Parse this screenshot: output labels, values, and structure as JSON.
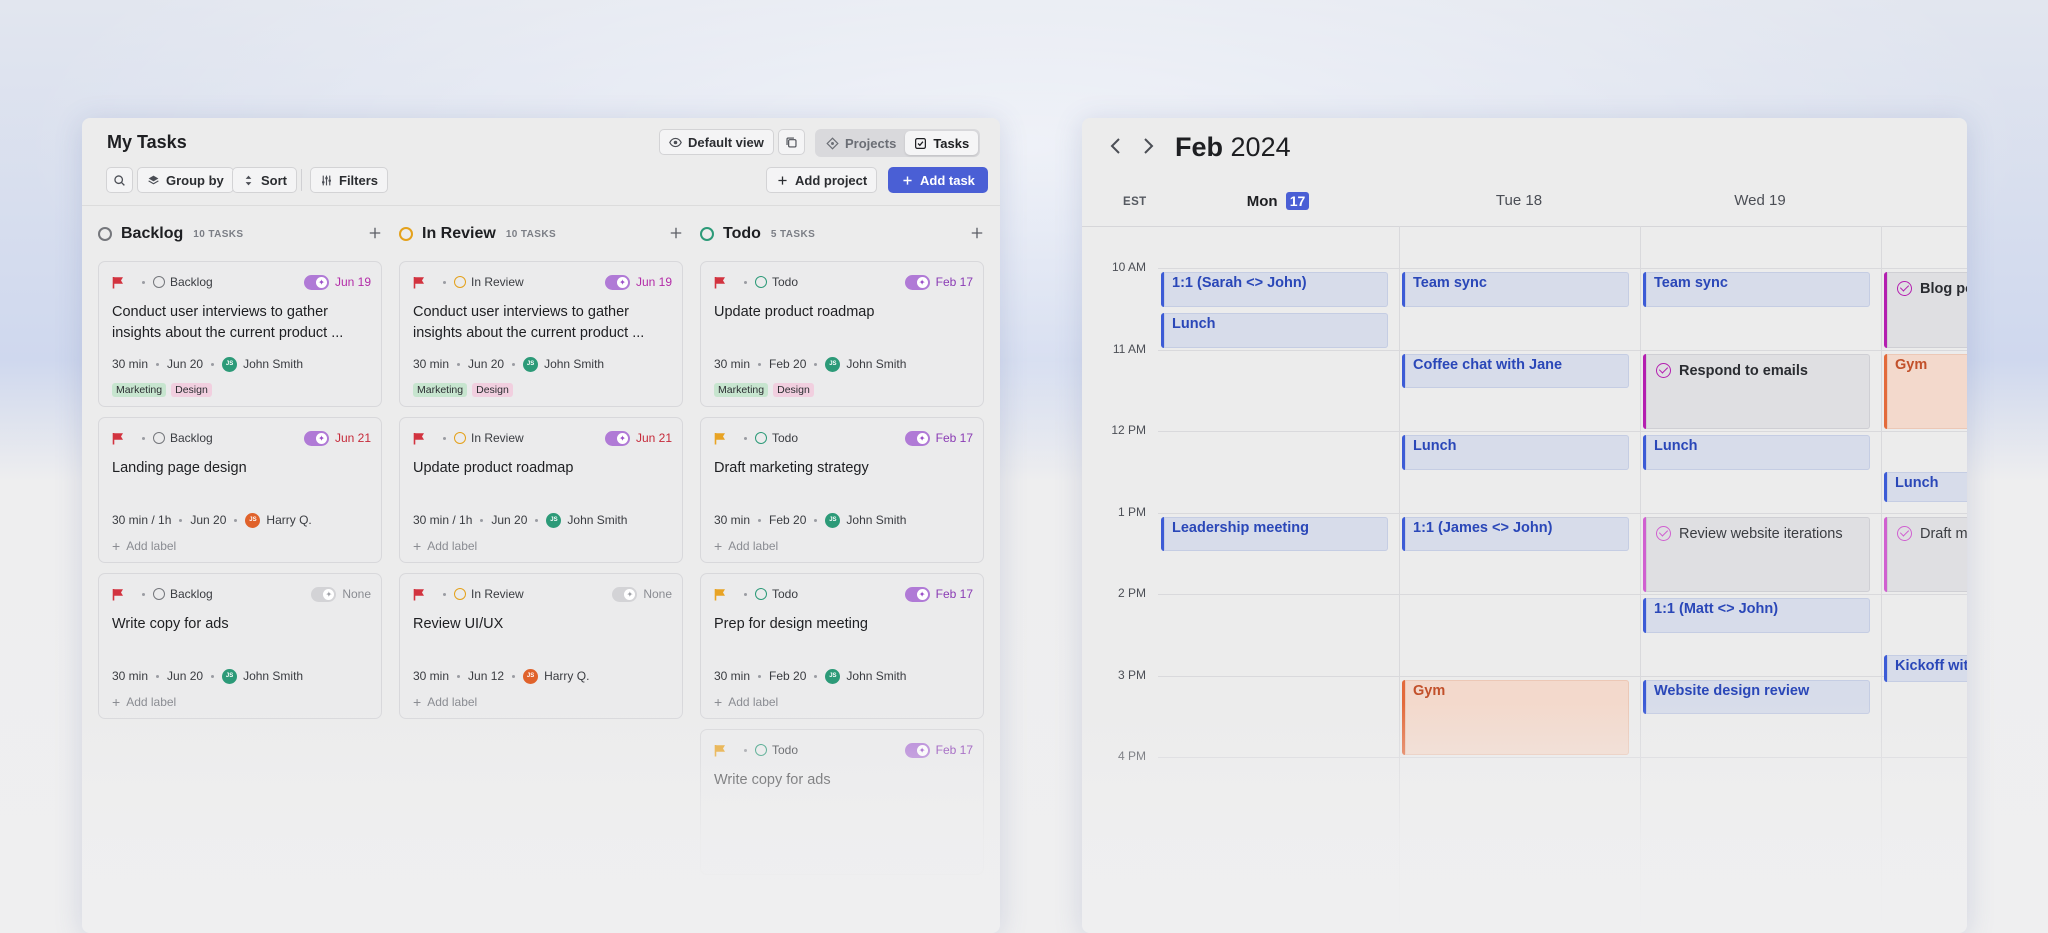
{
  "tasks": {
    "title": "My Tasks",
    "default_view_label": "Default view",
    "segments": [
      {
        "label": "Projects",
        "active": false
      },
      {
        "label": "Tasks",
        "active": true
      }
    ],
    "toolbar": {
      "group_by_label": "Group by",
      "sort_label": "Sort",
      "filters_label": "Filters",
      "add_project_label": "Add project",
      "add_task_label": "Add task"
    },
    "columns": [
      {
        "name": "Backlog",
        "count": "10 TASKS",
        "color": "#75777c",
        "cards": [
          {
            "status": "Backlog",
            "flag_color": "#d2333f",
            "auto": true,
            "due": "Jun 19",
            "due_color": "#b32ca8",
            "title": "Conduct user interviews to gather insights about the current product ...",
            "duration": "30 min",
            "date": "Jun 20",
            "assignee": "John Smith",
            "initials": "JS",
            "avatar_color": "#2c9a78",
            "tags": [
              "Marketing",
              "Design"
            ],
            "add_label": ""
          },
          {
            "status": "Backlog",
            "flag_color": "#d2333f",
            "auto": true,
            "due": "Jun 21",
            "due_color": "#c62a3a",
            "title": "Landing page design",
            "duration": "30 min / 1h",
            "date": "Jun 20",
            "assignee": "Harry Q.",
            "initials": "JS",
            "avatar_color": "#e0622b",
            "tags": [],
            "add_label": "Add label"
          },
          {
            "status": "Backlog",
            "flag_color": "#d2333f",
            "auto": false,
            "due": "None",
            "due_color": "#8a8c92",
            "title": "Write copy for ads",
            "duration": "30 min",
            "date": "Jun 20",
            "assignee": "John Smith",
            "initials": "JS",
            "avatar_color": "#2c9a78",
            "tags": [],
            "add_label": "Add label"
          }
        ]
      },
      {
        "name": "In Review",
        "count": "10 TASKS",
        "color": "#e4a11b",
        "cards": [
          {
            "status": "In Review",
            "flag_color": "#d2333f",
            "auto": true,
            "due": "Jun 19",
            "due_color": "#b32ca8",
            "title": "Conduct user interviews to gather insights about the current product ...",
            "duration": "30 min",
            "date": "Jun 20",
            "assignee": "John Smith",
            "initials": "JS",
            "avatar_color": "#2c9a78",
            "tags": [
              "Marketing",
              "Design"
            ],
            "add_label": ""
          },
          {
            "status": "In Review",
            "flag_color": "#d2333f",
            "auto": true,
            "due": "Jun 21",
            "due_color": "#c62a3a",
            "title": "Update product roadmap",
            "duration": "30 min / 1h",
            "date": "Jun 20",
            "assignee": "John Smith",
            "initials": "JS",
            "avatar_color": "#2c9a78",
            "tags": [],
            "add_label": "Add label"
          },
          {
            "status": "In Review",
            "flag_color": "#d2333f",
            "auto": false,
            "due": "None",
            "due_color": "#8a8c92",
            "title": "Review UI/UX",
            "duration": "30 min",
            "date": "Jun 12",
            "assignee": "Harry Q.",
            "initials": "JS",
            "avatar_color": "#e0622b",
            "tags": [],
            "add_label": "Add label"
          }
        ]
      },
      {
        "name": "Todo",
        "count": "5 TASKS",
        "color": "#2c9a78",
        "cards": [
          {
            "status": "Todo",
            "flag_color": "#d2333f",
            "auto": true,
            "due": "Feb 17",
            "due_color": "#8a3bb4",
            "title": "Update product roadmap",
            "duration": "30 min",
            "date": "Feb 20",
            "assignee": "John Smith",
            "initials": "JS",
            "avatar_color": "#2c9a78",
            "tags": [
              "Marketing",
              "Design"
            ],
            "add_label": ""
          },
          {
            "status": "Todo",
            "flag_color": "#e8a324",
            "auto": true,
            "due": "Feb 17",
            "due_color": "#8a3bb4",
            "title": "Draft marketing strategy",
            "duration": "30 min",
            "date": "Feb 20",
            "assignee": "John Smith",
            "initials": "JS",
            "avatar_color": "#2c9a78",
            "tags": [],
            "add_label": "Add label"
          },
          {
            "status": "Todo",
            "flag_color": "#e8a324",
            "auto": true,
            "due": "Feb 17",
            "due_color": "#8a3bb4",
            "title": "Prep for design meeting",
            "duration": "30 min",
            "date": "Feb 20",
            "assignee": "John Smith",
            "initials": "JS",
            "avatar_color": "#2c9a78",
            "tags": [],
            "add_label": "Add label"
          },
          {
            "status": "Todo",
            "flag_color": "#e8a324",
            "auto": true,
            "due": "Feb 17",
            "due_color": "#8a3bb4",
            "title": "Write copy for ads",
            "duration": "",
            "date": "",
            "assignee": "",
            "initials": "",
            "avatar_color": "#2c9a78",
            "tags": [],
            "add_label": ""
          }
        ]
      }
    ]
  },
  "calendar": {
    "month": "Feb",
    "year": "2024",
    "timezone": "EST",
    "days": [
      {
        "name": "Mon",
        "num": "17",
        "today": true
      },
      {
        "name": "Tue",
        "num": "18",
        "today": false
      },
      {
        "name": "Wed",
        "num": "19",
        "today": false
      }
    ],
    "hours": [
      "10 AM",
      "11 AM",
      "12 PM",
      "1 PM",
      "2 PM",
      "3 PM",
      "4 PM"
    ],
    "events": [
      {
        "day": 0,
        "start": 10.0,
        "end": 10.5,
        "title": "1:1 (Sarah <> John)",
        "kind": "blue"
      },
      {
        "day": 0,
        "start": 10.5,
        "end": 11.0,
        "title": "Lunch",
        "kind": "blue"
      },
      {
        "day": 0,
        "start": 13.0,
        "end": 13.5,
        "title": "Leadership meeting",
        "kind": "blue"
      },
      {
        "day": 1,
        "start": 10.0,
        "end": 10.5,
        "title": "Team sync",
        "kind": "blue"
      },
      {
        "day": 1,
        "start": 11.0,
        "end": 11.5,
        "title": "Coffee chat with Jane",
        "kind": "blue"
      },
      {
        "day": 1,
        "start": 12.0,
        "end": 12.5,
        "title": "Lunch",
        "kind": "blue"
      },
      {
        "day": 1,
        "start": 13.0,
        "end": 13.5,
        "title": "1:1 (James <> John)",
        "kind": "blue"
      },
      {
        "day": 1,
        "start": 15.0,
        "end": 16.0,
        "title": "Gym",
        "kind": "gym"
      },
      {
        "day": 2,
        "start": 10.0,
        "end": 10.5,
        "title": "Team sync",
        "kind": "blue"
      },
      {
        "day": 2,
        "start": 11.0,
        "end": 12.0,
        "title": "Respond to emails",
        "kind": "task"
      },
      {
        "day": 2,
        "start": 12.0,
        "end": 12.5,
        "title": "Lunch",
        "kind": "blue"
      },
      {
        "day": 2,
        "start": 13.0,
        "end": 14.0,
        "title": "Review website iterations",
        "kind": "task-light"
      },
      {
        "day": 2,
        "start": 14.0,
        "end": 14.5,
        "title": "1:1 (Matt <> John)",
        "kind": "blue"
      },
      {
        "day": 2,
        "start": 15.0,
        "end": 15.5,
        "title": "Website design review",
        "kind": "blue"
      },
      {
        "day": 3,
        "start": 10.0,
        "end": 11.0,
        "title": "Blog po",
        "kind": "task"
      },
      {
        "day": 3,
        "start": 11.0,
        "end": 12.0,
        "title": "Gym",
        "kind": "gym"
      },
      {
        "day": 3,
        "start": 12.45,
        "end": 12.9,
        "title": "Lunch",
        "kind": "blue"
      },
      {
        "day": 3,
        "start": 13.0,
        "end": 14.0,
        "title": "Draft m",
        "kind": "task-light"
      },
      {
        "day": 3,
        "start": 14.7,
        "end": 15.1,
        "title": "Kickoff wit",
        "kind": "blue"
      }
    ]
  },
  "colors": {
    "accent": "#4a5fd5",
    "event_blue": "#3c5bd6",
    "task_magenta": "#b41fb0",
    "gym_orange": "#e36a3b"
  },
  "icons": {
    "search": "search-icon",
    "layers": "layers-icon",
    "sort": "sort-icon",
    "filters": "sliders-icon",
    "eye": "eye-icon",
    "copy": "copy-icon",
    "projects": "diamond-icon",
    "tasks": "checkbox-icon",
    "flag": "flag-icon",
    "auto_schedule": "sparkle-icon",
    "plus": "plus-icon",
    "prev": "chevron-left-icon",
    "next": "chevron-right-icon"
  }
}
